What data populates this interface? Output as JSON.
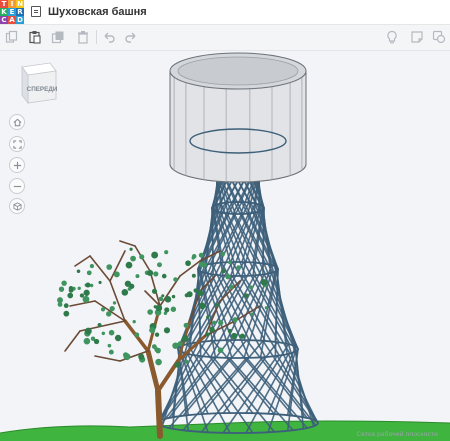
{
  "logo": {
    "letters": [
      "T",
      "I",
      "N",
      "K",
      "E",
      "R",
      "C",
      "A",
      "D"
    ],
    "colors": [
      "#e84d3d",
      "#f39c33",
      "#f5c518",
      "#27ae60",
      "#2a9fd6",
      "#1f6fb5",
      "#8e44ad",
      "#e84d3d",
      "#2a9fd6"
    ]
  },
  "header": {
    "title": "Шуховская башня"
  },
  "toolbar": {
    "left": [
      "copy-icon",
      "paste-icon",
      "duplicate-icon",
      "delete-icon",
      "undo-icon",
      "redo-icon"
    ],
    "right": [
      "lightbulb-icon",
      "note-icon",
      "shape-icon"
    ]
  },
  "viewcube": {
    "face_label": "СПЕРЕДИ"
  },
  "grid": {
    "label": "Сетка рабочей плоскости"
  },
  "colors": {
    "tower": "#3d5f7a",
    "tank": "#e1e3e6",
    "ground": "#3fb43f",
    "trunk": "#8a5a2e",
    "foliage": "#2f7a4a"
  }
}
